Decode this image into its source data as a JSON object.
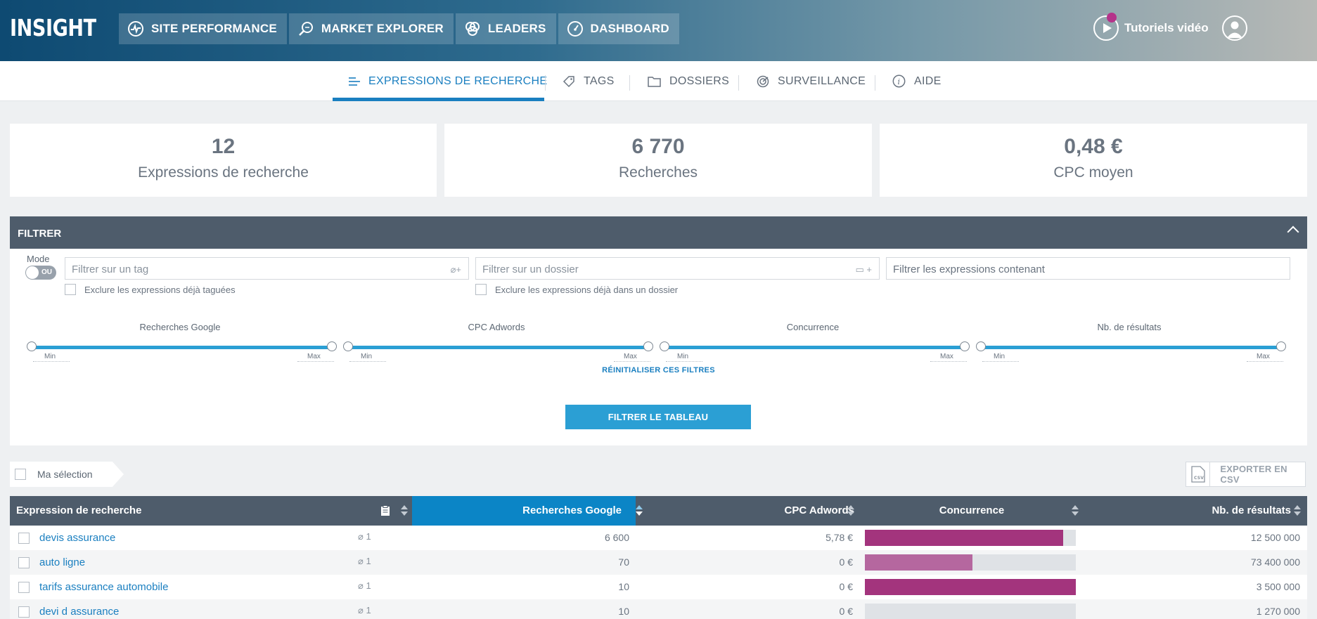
{
  "app": {
    "logo": "INSIGHT"
  },
  "main_nav": [
    {
      "label": "SITE PERFORMANCE",
      "icon": "pulse-icon"
    },
    {
      "label": "MARKET EXPLORER",
      "icon": "magnifier-icon"
    },
    {
      "label": "LEADERS",
      "icon": "circles-icon"
    },
    {
      "label": "DASHBOARD",
      "icon": "gauge-icon"
    }
  ],
  "header_right": {
    "tutorials_label": "Tutoriels vidéo"
  },
  "sub_nav": {
    "tabs": [
      {
        "label": "EXPRESSIONS DE RECHERCHE",
        "active": true
      },
      {
        "label": "TAGS"
      },
      {
        "label": "DOSSIERS"
      },
      {
        "label": "SURVEILLANCE"
      },
      {
        "label": "AIDE"
      }
    ]
  },
  "stats": [
    {
      "value": "12",
      "label": "Expressions de recherche"
    },
    {
      "value": "6 770",
      "label": "Recherches"
    },
    {
      "value": "0,48 €",
      "label": "CPC moyen"
    }
  ],
  "filter": {
    "title": "FILTRER",
    "mode_label": "Mode",
    "mode_value": "OU",
    "tag_placeholder": "Filtrer sur un tag",
    "folder_placeholder": "Filtrer sur un dossier",
    "contains_placeholder": "Filtrer les expressions contenant",
    "exclude_tagged": "Exclure les expressions déjà taguées",
    "exclude_foldered": "Exclure les expressions déjà dans un dossier",
    "sliders": [
      {
        "title": "Recherches Google",
        "min": "Min",
        "max": "Max"
      },
      {
        "title": "CPC Adwords",
        "min": "Min",
        "max": "Max"
      },
      {
        "title": "Concurrence",
        "min": "Min",
        "max": "Max"
      },
      {
        "title": "Nb. de résultats",
        "min": "Min",
        "max": "Max"
      }
    ],
    "reset_label": "RÉINITIALISER CES FILTRES",
    "apply_label": "FILTRER LE TABLEAU"
  },
  "selection": {
    "label": "Ma sélection"
  },
  "export": {
    "label": "EXPORTER EN CSV",
    "file_icon_text": "CSV"
  },
  "table": {
    "headers": {
      "expression": "Expression de recherche",
      "google": "Recherches Google",
      "cpc": "CPC Adwords",
      "competition": "Concurrence",
      "results": "Nb. de résultats"
    },
    "rows": [
      {
        "expression": "devis assurance",
        "tags": "1",
        "google": "6 600",
        "cpc": "5,78 €",
        "competition": 0.94,
        "results": "12 500 000"
      },
      {
        "expression": "auto ligne",
        "tags": "1",
        "google": "70",
        "cpc": "0 €",
        "competition": 0.51,
        "results": "73 400 000"
      },
      {
        "expression": "tarifs assurance automobile",
        "tags": "1",
        "google": "10",
        "cpc": "0 €",
        "competition": 1.0,
        "results": "3 500 000"
      },
      {
        "expression": "devi d assurance",
        "tags": "1",
        "google": "10",
        "cpc": "0 €",
        "competition": 0.0,
        "results": "1 270 000"
      }
    ]
  },
  "colors": {
    "accent": "#2b9fd4",
    "link": "#1a7fc0",
    "competition_high": "#a3347d",
    "competition_mid": "#b5679f",
    "header_bg": "#4e5c6b"
  }
}
